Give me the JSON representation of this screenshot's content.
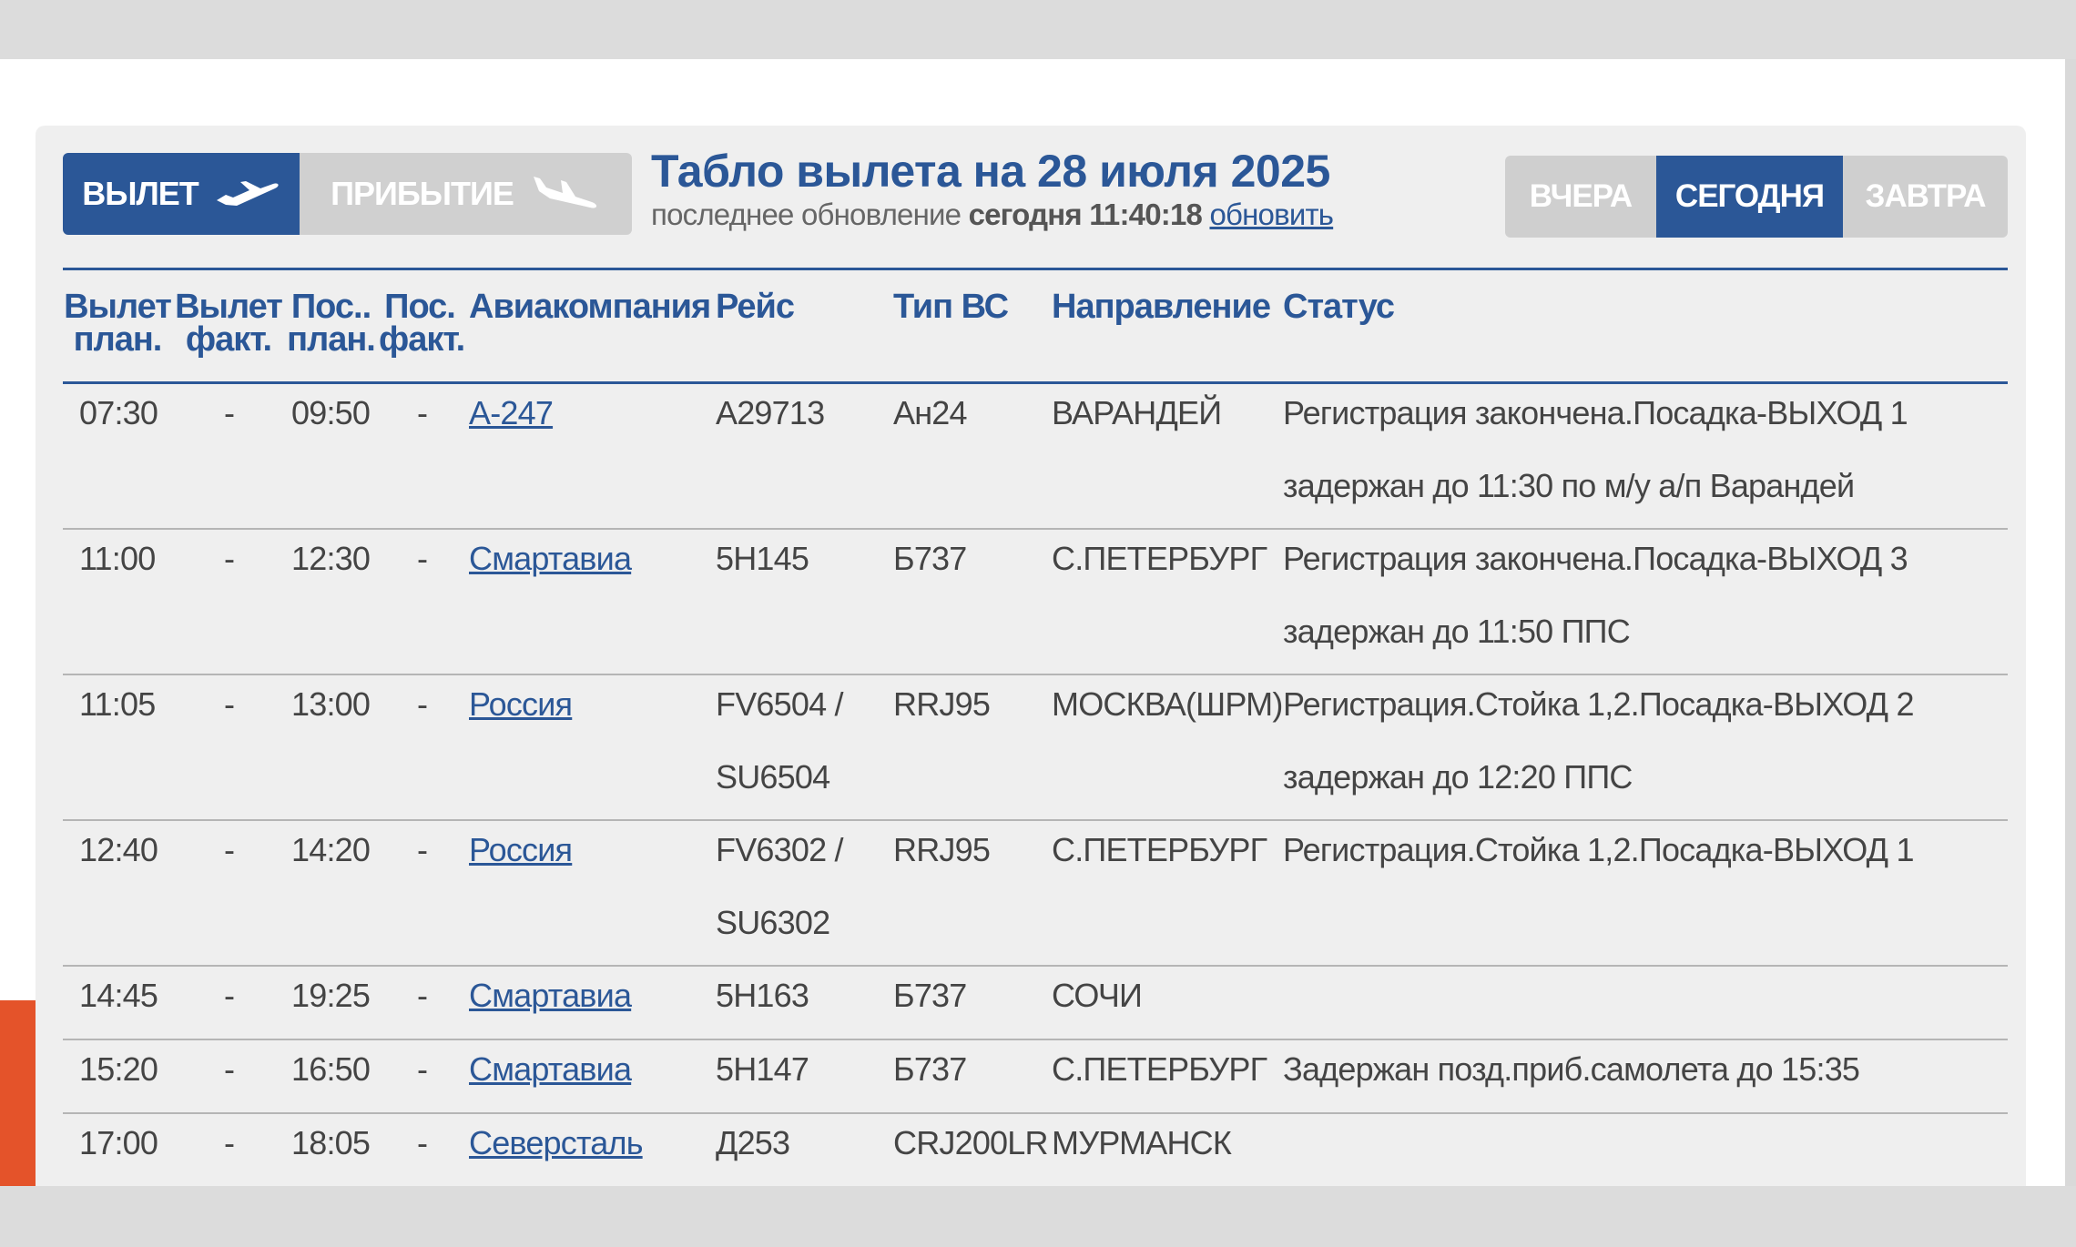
{
  "direction_tabs": {
    "departure_label": "ВЫЛЕТ",
    "arrival_label": "ПРИБЫТИЕ",
    "active": "departure",
    "departure_icon": "plane-takeoff-icon",
    "arrival_icon": "plane-landing-icon"
  },
  "header": {
    "title": "Табло вылета на 28 июля 2025",
    "update_prefix": "последнее обновление",
    "update_time": "сегодня 11:40:18",
    "refresh_label": "обновить"
  },
  "day_tabs": {
    "yesterday": "ВЧЕРА",
    "today": "СЕГОДНЯ",
    "tomorrow": "ЗАВТРА",
    "active": "today"
  },
  "colors": {
    "accent": "#2b5797",
    "inactive_button": "#d0d0d0",
    "panel": "#efefef",
    "side_accent": "#e4532a"
  },
  "table": {
    "columns": [
      {
        "line1": "Вылет",
        "line2": "план."
      },
      {
        "line1": "Вылет",
        "line2": "факт."
      },
      {
        "line1": "Пос..",
        "line2": "план."
      },
      {
        "line1": "Пос.",
        "line2": "факт."
      },
      {
        "line1": "Авиакомпания",
        "line2": ""
      },
      {
        "line1": "Рейс",
        "line2": ""
      },
      {
        "line1": "Тип ВС",
        "line2": ""
      },
      {
        "line1": "Направление",
        "line2": ""
      },
      {
        "line1": "Статус",
        "line2": ""
      }
    ],
    "rows": [
      {
        "dep_plan": "07:30",
        "dep_fact": "-",
        "land_plan": "09:50",
        "land_fact": "-",
        "airline": "А-247",
        "flight": [
          "A29713"
        ],
        "aircraft": "Ан24",
        "destination": "ВАРАНДЕЙ",
        "status": [
          "Регистрация закончена.Посадка-ВЫХОД 1",
          "задержан до 11:30 по м/у а/п Варандей"
        ]
      },
      {
        "dep_plan": "11:00",
        "dep_fact": "-",
        "land_plan": "12:30",
        "land_fact": "-",
        "airline": "Смартавиа",
        "flight": [
          "5Н145"
        ],
        "aircraft": "Б737",
        "destination": "С.ПЕТЕРБУРГ",
        "status": [
          "Регистрация закончена.Посадка-ВЫХОД 3",
          "задержан до 11:50 ППС"
        ]
      },
      {
        "dep_plan": "11:05",
        "dep_fact": "-",
        "land_plan": "13:00",
        "land_fact": "-",
        "airline": "Россия",
        "flight": [
          "FV6504 /",
          "SU6504"
        ],
        "aircraft": "RRJ95",
        "destination": "МОСКВА(ШРМ)",
        "status": [
          "Регистрация.Стойка 1,2.Посадка-ВЫХОД 2",
          "задержан до 12:20 ППС"
        ]
      },
      {
        "dep_plan": "12:40",
        "dep_fact": "-",
        "land_plan": "14:20",
        "land_fact": "-",
        "airline": "Россия",
        "flight": [
          "FV6302 /",
          "SU6302"
        ],
        "aircraft": "RRJ95",
        "destination": "С.ПЕТЕРБУРГ",
        "status": [
          "Регистрация.Стойка 1,2.Посадка-ВЫХОД 1"
        ]
      },
      {
        "dep_plan": "14:45",
        "dep_fact": "-",
        "land_plan": "19:25",
        "land_fact": "-",
        "airline": "Смартавиа",
        "flight": [
          "5Н163"
        ],
        "aircraft": "Б737",
        "destination": "СОЧИ",
        "status": [
          ""
        ]
      },
      {
        "dep_plan": "15:20",
        "dep_fact": "-",
        "land_plan": "16:50",
        "land_fact": "-",
        "airline": "Смартавиа",
        "flight": [
          "5Н147"
        ],
        "aircraft": "Б737",
        "destination": "С.ПЕТЕРБУРГ",
        "status": [
          "Задержан позд.приб.самолета до 15:35"
        ]
      },
      {
        "dep_plan": "17:00",
        "dep_fact": "-",
        "land_plan": "18:05",
        "land_fact": "-",
        "airline": "Северсталь",
        "flight": [
          "Д253"
        ],
        "aircraft": "CRJ200LR",
        "destination": "МУРМАНСК",
        "status": [
          ""
        ]
      }
    ]
  }
}
